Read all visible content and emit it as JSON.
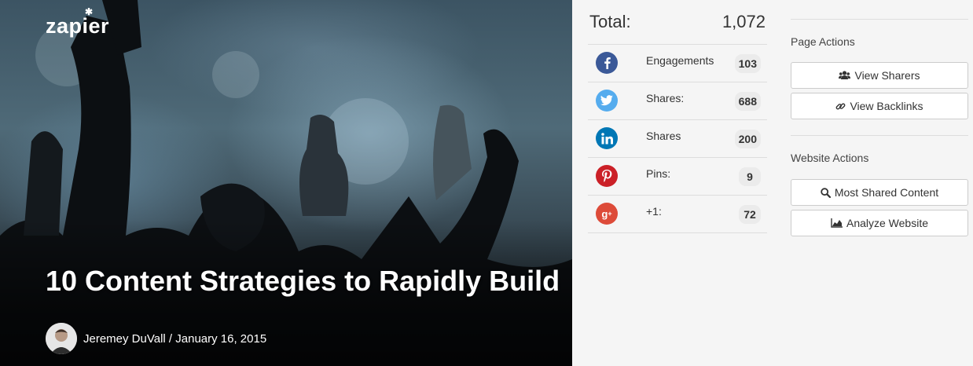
{
  "hero": {
    "logo_text": "zapier",
    "title": "10 Content Strategies to Rapidly Build",
    "byline": "Jeremey DuVall / January 16, 2015"
  },
  "stats": {
    "total_label": "Total:",
    "total_value": "1,072",
    "rows": [
      {
        "network": "facebook",
        "icon": "facebook-icon",
        "color": "#3b5998",
        "label": "Engagements",
        "count": "103"
      },
      {
        "network": "twitter",
        "icon": "twitter-icon",
        "color": "#55acee",
        "label": "Shares:",
        "count": "688"
      },
      {
        "network": "linkedin",
        "icon": "linkedin-icon",
        "color": "#0077b5",
        "label": "Shares",
        "count": "200"
      },
      {
        "network": "pinterest",
        "icon": "pinterest-icon",
        "color": "#cb2027",
        "label": "Pins:",
        "count": "9"
      },
      {
        "network": "googleplus",
        "icon": "google-plus-icon",
        "color": "#dd4b39",
        "label": "+1:",
        "count": "72"
      }
    ]
  },
  "actions": {
    "page_title": "Page Actions",
    "view_sharers": "View Sharers",
    "view_backlinks": "View Backlinks",
    "website_title": "Website Actions",
    "most_shared": "Most Shared Content",
    "analyze": "Analyze Website"
  }
}
